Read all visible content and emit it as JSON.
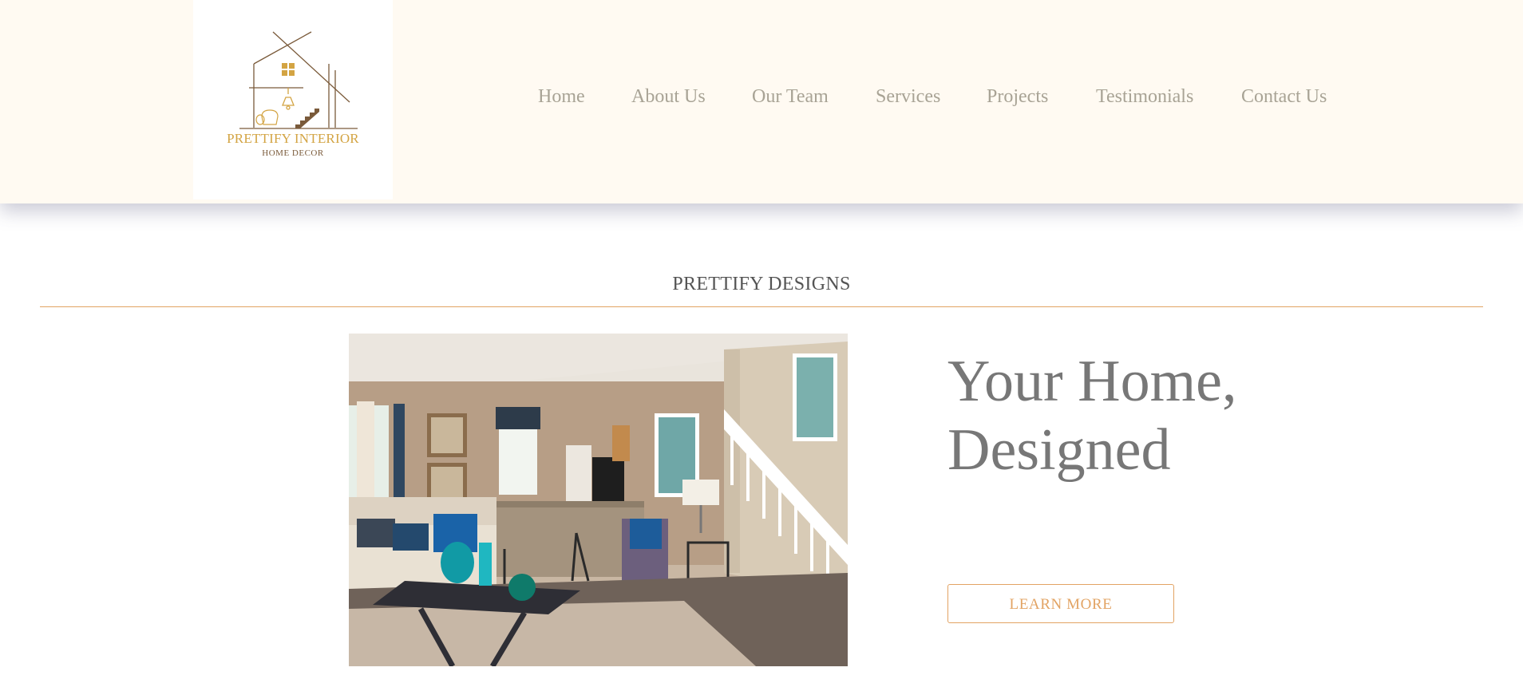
{
  "brand": {
    "name": "PRETTIFY INTERIOR",
    "tagline": "HOME DECOR",
    "logo_icon": "house-stairs-lamp-icon",
    "gold": "#d3a443",
    "brown": "#7a5a3a"
  },
  "nav": {
    "items": [
      "Home",
      "About Us",
      "Our Team",
      "Services",
      "Projects",
      "Testimonials",
      "Contact Us"
    ]
  },
  "section": {
    "title": "PRETTIFY DESIGNS"
  },
  "hero": {
    "heading": "Your Home, Designed",
    "button_label": "LEARN MORE",
    "photo": "living-room-interior-photo"
  },
  "colors": {
    "header_bg": "#fffaf2",
    "nav_text": "#a8a395",
    "accent": "#e2a363",
    "heading_text": "#777777",
    "section_title_text": "#545454"
  }
}
